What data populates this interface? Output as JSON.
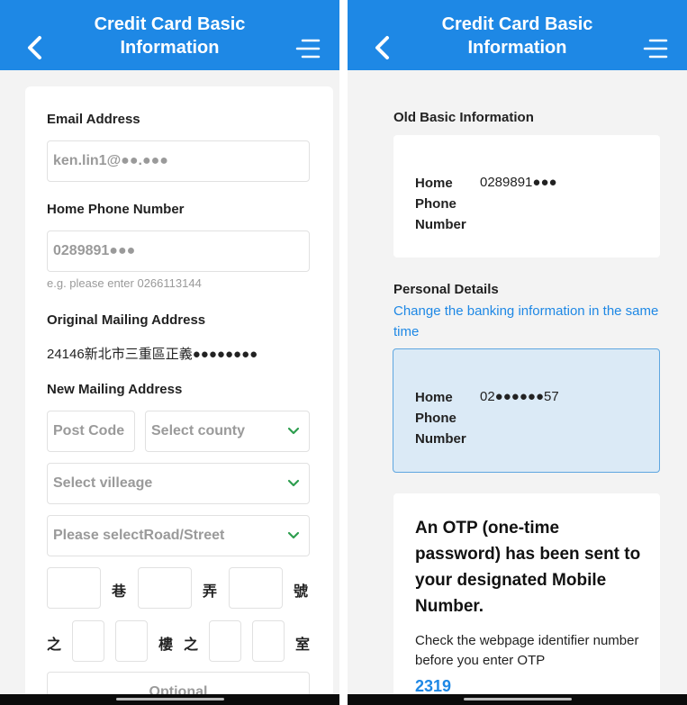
{
  "left": {
    "header": {
      "title": "Credit Card Basic Information"
    },
    "email": {
      "label": "Email Address",
      "value": "ken.lin1@●●.●●●"
    },
    "home_phone": {
      "label": "Home Phone Number",
      "value": "0289891●●●",
      "hint": "e.g. please enter 0266113144"
    },
    "original_address": {
      "label": "Original Mailing Address",
      "value": "24146新北市三重區正義●●●●●●●●"
    },
    "new_address": {
      "label": "New Mailing Address",
      "post_code_placeholder": "Post Code",
      "county_placeholder": "Select county",
      "village_placeholder": "Select villeage",
      "road_placeholder": "Please selectRoad/Street",
      "lane": "巷",
      "alley": "弄",
      "number": "號",
      "of": "之",
      "floor": "樓",
      "of2": "之",
      "room": "室",
      "optional_placeholder": "Optional"
    }
  },
  "right": {
    "header": {
      "title": "Credit Card Basic Information"
    },
    "old_info": {
      "section_title": "Old Basic Information",
      "label": "Home Phone Number",
      "value": "0289891●●●"
    },
    "personal": {
      "section_title": "Personal Details",
      "link": "Change the banking information in the same time",
      "label": "Home Phone Number",
      "value": "02●●●●●●57"
    },
    "otp": {
      "title": "An OTP (one-time password) has been sent to your designated Mobile Number.",
      "body": "Check the webpage identifier number before you enter OTP",
      "code": "2319"
    }
  },
  "colors": {
    "primary": "#1e88e5",
    "chevron": "#2e9e4f",
    "highlight": "#dbeaf6"
  },
  "icons": {
    "back": "chevron-left-icon",
    "menu": "menu-icon",
    "dropdown": "chevron-down-icon"
  }
}
